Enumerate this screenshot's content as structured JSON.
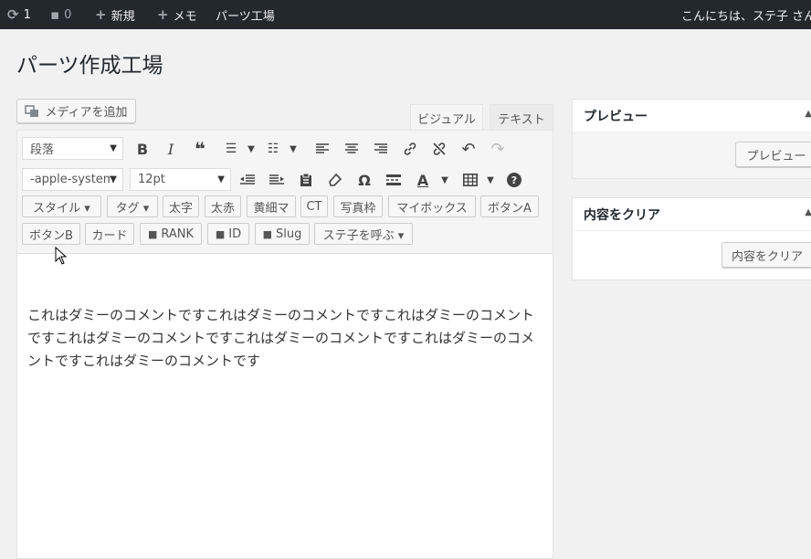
{
  "admin_bar": {
    "updates_count": "1",
    "comments_count": "0",
    "new_label": "新規",
    "memo_label": "メモ",
    "site_label": "パーツ工場",
    "greeting": "こんにちは、ステ子 さん"
  },
  "page": {
    "title": "パーツ作成工場"
  },
  "editor": {
    "media_button": "メディアを追加",
    "tab_visual": "ビジュアル",
    "tab_text": "テキスト",
    "format_select": "段落",
    "font_family_select": "-apple-system",
    "font_size_select": "12pt",
    "quicktags_row1": [
      "スタイル ▾",
      "タグ ▾",
      "太字",
      "太赤",
      "黄細マ",
      "CT",
      "写真枠",
      "マイボックス",
      "ボタンA"
    ],
    "quicktags_row2": [
      "ボタンB",
      "カード",
      "RANK",
      "ID",
      "Slug",
      "ステ子を呼ぶ ▾"
    ],
    "content": "これはダミーのコメントですこれはダミーのコメントですこれはダミーのコメントですこれはダミーのコメントですこれはダミーのコメントですこれはダミーのコメントですこれはダミーのコメントです"
  },
  "sidebar": {
    "preview_box": {
      "title": "プレビュー",
      "button": "プレビュー"
    },
    "clear_box": {
      "title": "内容をクリア",
      "button": "内容をクリア"
    }
  },
  "colors": {
    "admin_bar_bg": "#23282d",
    "page_bg": "#f1f1f1",
    "toolbar_bg": "#f5f5f5"
  }
}
